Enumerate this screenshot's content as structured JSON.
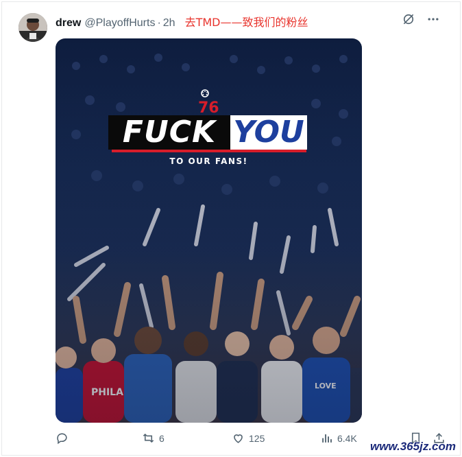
{
  "tweet": {
    "author_name": "drew",
    "handle": "@PlayoffHurts",
    "separator": "·",
    "time": "2h",
    "text": "去TMD——致我们的粉丝"
  },
  "top_icons": [
    "grok-icon",
    "more-icon"
  ],
  "media": {
    "logo": "76",
    "headline_left": "FUCK",
    "headline_right": "YOU",
    "subline": "TO OUR FANS!",
    "colors": {
      "red": "#d71d2a",
      "blue": "#1d3f9e",
      "crowd": "#15284f"
    }
  },
  "actions": {
    "reply_count": "",
    "retweet_count": "6",
    "like_count": "125",
    "views_count": "6.4K"
  },
  "watermark": "www.365jz.com"
}
